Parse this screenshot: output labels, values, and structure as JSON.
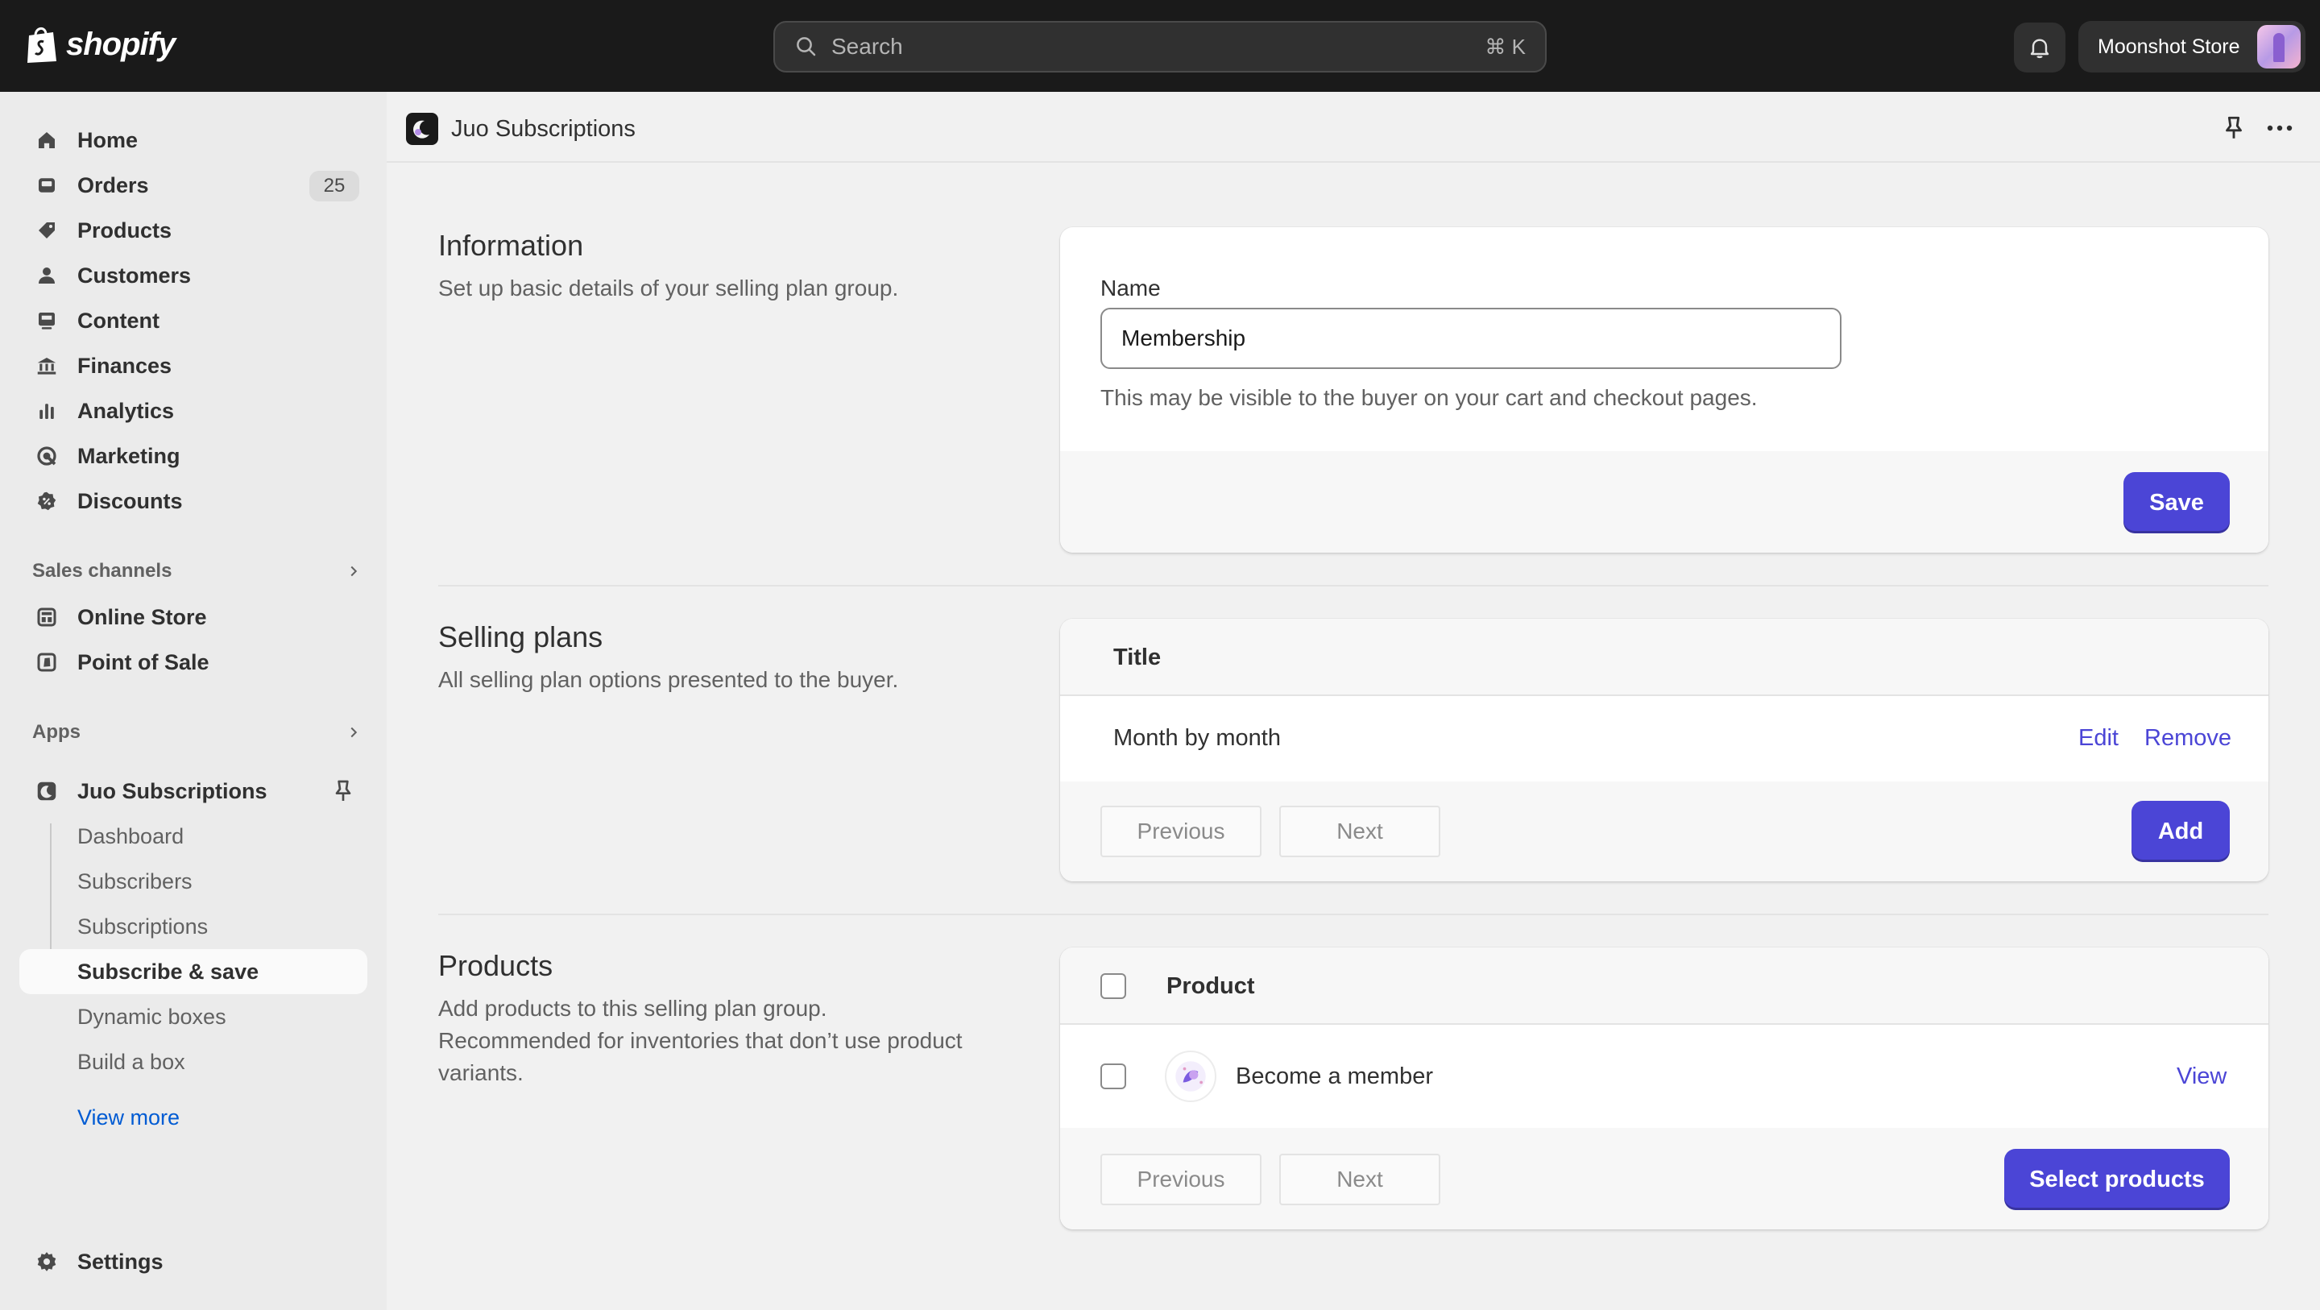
{
  "topbar": {
    "brand": "shopify",
    "search_placeholder": "Search",
    "search_shortcut": "⌘ K",
    "store_name": "Moonshot Store"
  },
  "sidebar": {
    "items": [
      {
        "label": "Home",
        "icon": "home-icon"
      },
      {
        "label": "Orders",
        "icon": "inbox-icon",
        "badge": "25"
      },
      {
        "label": "Products",
        "icon": "tag-icon"
      },
      {
        "label": "Customers",
        "icon": "person-icon"
      },
      {
        "label": "Content",
        "icon": "content-icon"
      },
      {
        "label": "Finances",
        "icon": "bank-icon"
      },
      {
        "label": "Analytics",
        "icon": "bar-chart-icon"
      },
      {
        "label": "Marketing",
        "icon": "target-icon"
      },
      {
        "label": "Discounts",
        "icon": "discount-icon"
      }
    ],
    "sales_channels_label": "Sales channels",
    "sales_channels": [
      {
        "label": "Online Store",
        "icon": "store-icon"
      },
      {
        "label": "Point of Sale",
        "icon": "pos-icon"
      }
    ],
    "apps_label": "Apps",
    "app_name": "Juo Subscriptions",
    "app_subitems": [
      "Dashboard",
      "Subscribers",
      "Subscriptions",
      "Subscribe & save",
      "Dynamic boxes",
      "Build a box"
    ],
    "active_subitem": "Subscribe & save",
    "view_more": "View more",
    "settings": "Settings"
  },
  "header": {
    "app_title": "Juo Subscriptions"
  },
  "information": {
    "title": "Information",
    "description": "Set up basic details of your selling plan group.",
    "name_label": "Name",
    "name_value": "Membership",
    "help_text": "This may be visible to the buyer on your cart and checkout pages.",
    "save_label": "Save"
  },
  "selling_plans": {
    "title": "Selling plans",
    "description": "All selling plan options presented to the buyer.",
    "column_title": "Title",
    "rows": [
      {
        "title": "Month by month",
        "edit": "Edit",
        "remove": "Remove"
      }
    ],
    "previous": "Previous",
    "next": "Next",
    "add_label": "Add"
  },
  "products": {
    "title": "Products",
    "description_line1": "Add products to this selling plan group.",
    "description_line2": "Recommended for inventories that don’t use product variants.",
    "column_product": "Product",
    "rows": [
      {
        "name": "Become a member",
        "view": "View"
      }
    ],
    "previous": "Previous",
    "next": "Next",
    "select_label": "Select products"
  },
  "colors": {
    "topbar": "#1a1a1a",
    "primary": "#4b45d6",
    "link_blue": "#005bd3"
  }
}
